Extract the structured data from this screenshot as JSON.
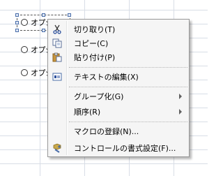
{
  "sheet": {
    "options": [
      {
        "label": "オプシ"
      },
      {
        "label": "オプシ"
      },
      {
        "label": "オプシ"
      }
    ]
  },
  "context_menu": {
    "items": [
      {
        "label": "切り取り(T)",
        "icon": "scissors-icon",
        "disabled": false
      },
      {
        "label": "コピー(C)",
        "icon": "copy-icon",
        "disabled": false
      },
      {
        "label": "貼り付け(P)",
        "icon": "paste-icon",
        "disabled": false
      },
      {
        "label": "テキストの編集(X)",
        "icon": "edit-text-icon",
        "disabled": false
      },
      {
        "label": "グループ化(G)",
        "icon": "",
        "submenu": true
      },
      {
        "label": "順序(R)",
        "icon": "",
        "submenu": true
      },
      {
        "label": "マクロの登録(N)...",
        "icon": "",
        "disabled": false
      },
      {
        "label": "コントロールの書式設定(F)...",
        "icon": "format-control-icon",
        "disabled": false
      }
    ]
  }
}
